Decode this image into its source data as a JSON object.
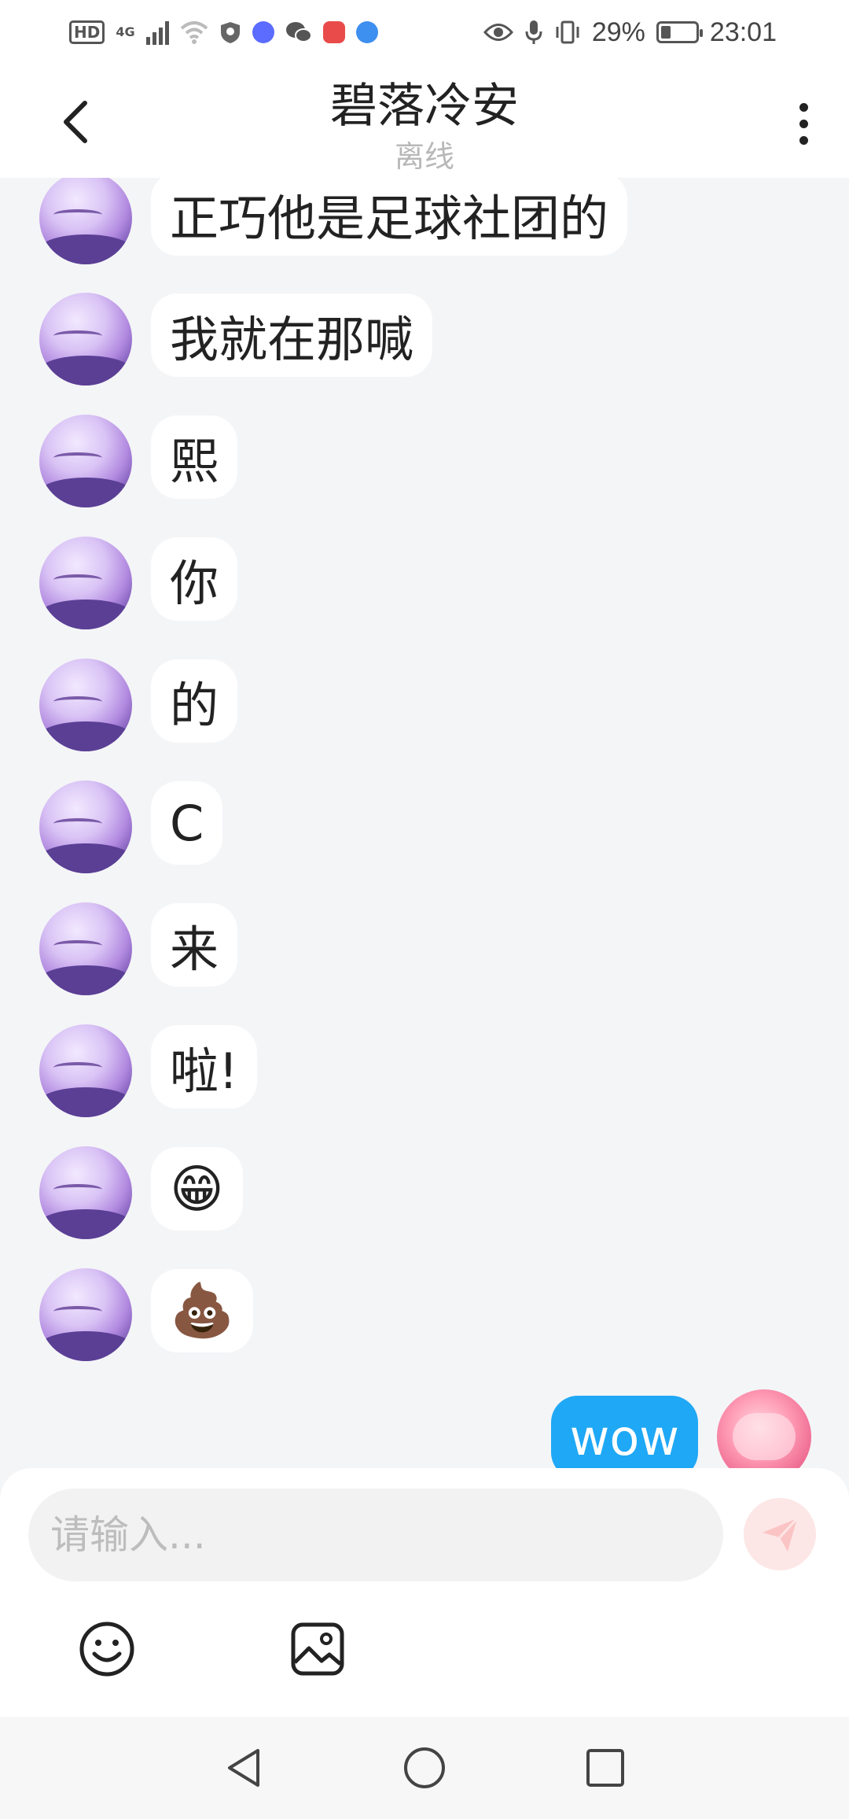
{
  "status_bar": {
    "hd_label": "HD",
    "network": "4G",
    "battery_percent_text": "29%",
    "battery_level": 0.29,
    "time": "23:01",
    "icons": [
      "signal-icon",
      "wifi-icon",
      "shield-icon",
      "music-app-icon",
      "wechat-icon",
      "book-app-icon",
      "browser-app-icon",
      "eye-icon",
      "mic-icon",
      "vibrate-icon",
      "battery-icon"
    ]
  },
  "header": {
    "title": "碧落冷安",
    "subtitle": "离线",
    "back_icon": "chevron-left-icon",
    "more_icon": "more-vertical-icon"
  },
  "messages": [
    {
      "sender": "other",
      "text": "正巧他是足球社团的"
    },
    {
      "sender": "other",
      "text": "我就在那喊"
    },
    {
      "sender": "other",
      "text": "熙"
    },
    {
      "sender": "other",
      "text": "你"
    },
    {
      "sender": "other",
      "text": "的"
    },
    {
      "sender": "other",
      "text": "C"
    },
    {
      "sender": "other",
      "text": "来"
    },
    {
      "sender": "other",
      "text": "啦!"
    },
    {
      "sender": "other",
      "text": "😁"
    },
    {
      "sender": "other",
      "text": "💩"
    },
    {
      "sender": "self",
      "text": "wow"
    }
  ],
  "input": {
    "placeholder": "请输入...",
    "value": ""
  },
  "toolbar": {
    "emoji_icon": "emoji-icon",
    "image_icon": "image-icon",
    "send_icon": "send-icon"
  },
  "nav": {
    "back_icon": "nav-back-icon",
    "home_icon": "nav-home-icon",
    "recents_icon": "nav-recents-icon"
  },
  "colors": {
    "self_bubble": "#1fa8f5",
    "background": "#f4f5f7",
    "send_button": "#fde6e6"
  }
}
